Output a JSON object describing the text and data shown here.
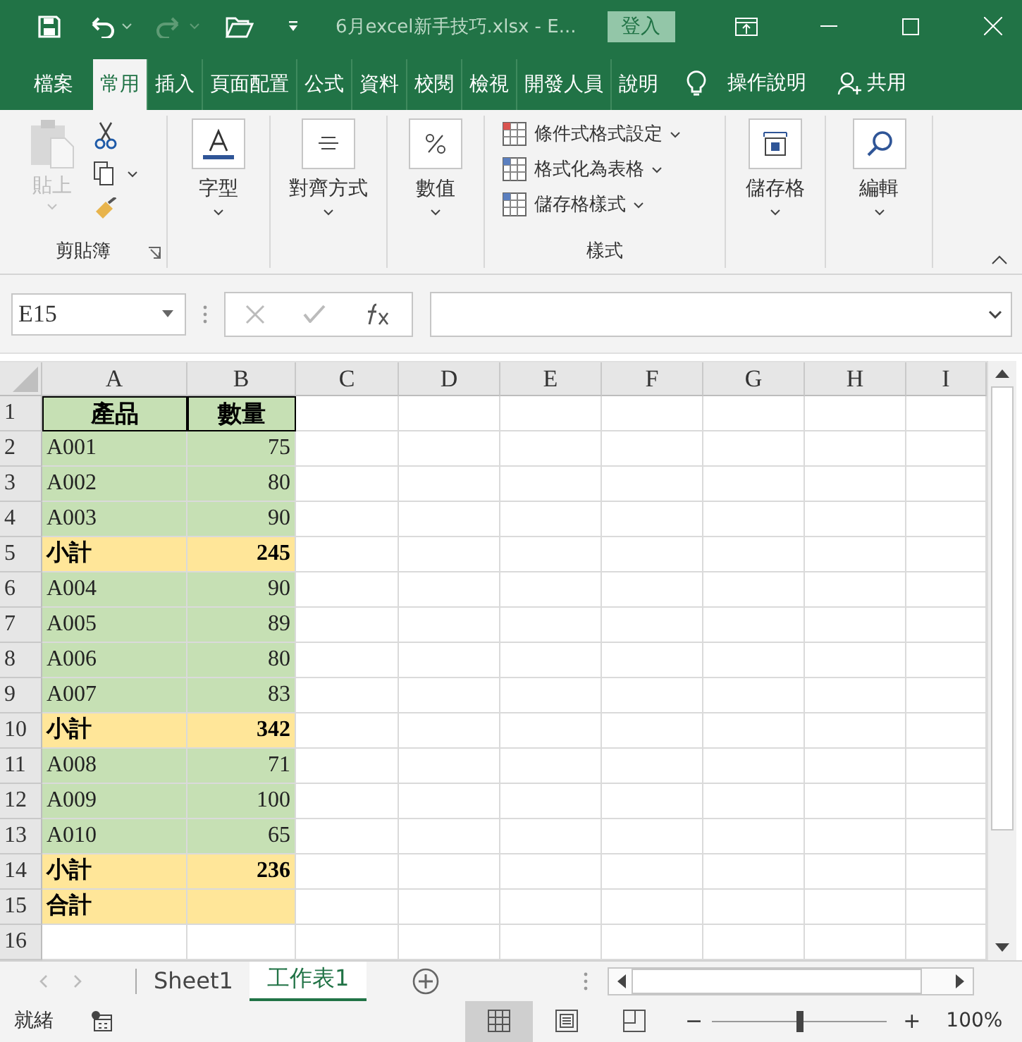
{
  "title_bar": {
    "file_title": "6月excel新手技巧.xlsx  -  E...",
    "sign_in": "登入"
  },
  "ribbon_tabs": [
    {
      "label": "檔案",
      "selected": false
    },
    {
      "label": "常用",
      "selected": true
    },
    {
      "label": "插入",
      "selected": false
    },
    {
      "label": "頁面配置",
      "selected": false
    },
    {
      "label": "公式",
      "selected": false
    },
    {
      "label": "資料",
      "selected": false
    },
    {
      "label": "校閱",
      "selected": false
    },
    {
      "label": "檢視",
      "selected": false
    },
    {
      "label": "開發人員",
      "selected": false
    },
    {
      "label": "說明",
      "selected": false
    }
  ],
  "tell_me": "操作說明",
  "share": "共用",
  "ribbon": {
    "paste": "貼上",
    "clipboard_label": "剪貼簿",
    "font": "字型",
    "alignment": "對齊方式",
    "number": "數值",
    "styles": [
      "條件式格式設定",
      "格式化為表格",
      "儲存格樣式"
    ],
    "styles_label": "樣式",
    "cells": "儲存格",
    "editing": "編輯"
  },
  "name_box": "E15",
  "columns": [
    "A",
    "B",
    "C",
    "D",
    "E",
    "F",
    "G",
    "H",
    "I"
  ],
  "rows": [
    {
      "number": "1",
      "kind": "header",
      "a": "產品",
      "b": "數量"
    },
    {
      "number": "2",
      "kind": "item",
      "a": "A001",
      "b": "75"
    },
    {
      "number": "3",
      "kind": "item",
      "a": "A002",
      "b": "80"
    },
    {
      "number": "4",
      "kind": "item",
      "a": "A003",
      "b": "90"
    },
    {
      "number": "5",
      "kind": "subtotal",
      "a": "小計",
      "b": "245"
    },
    {
      "number": "6",
      "kind": "item",
      "a": "A004",
      "b": "90"
    },
    {
      "number": "7",
      "kind": "item",
      "a": "A005",
      "b": "89"
    },
    {
      "number": "8",
      "kind": "item",
      "a": "A006",
      "b": "80"
    },
    {
      "number": "9",
      "kind": "item",
      "a": "A007",
      "b": "83"
    },
    {
      "number": "10",
      "kind": "subtotal",
      "a": "小計",
      "b": "342"
    },
    {
      "number": "11",
      "kind": "item",
      "a": "A008",
      "b": "71"
    },
    {
      "number": "12",
      "kind": "item",
      "a": "A009",
      "b": "100"
    },
    {
      "number": "13",
      "kind": "item",
      "a": "A010",
      "b": "65"
    },
    {
      "number": "14",
      "kind": "subtotal",
      "a": "小計",
      "b": "236"
    },
    {
      "number": "15",
      "kind": "subtotal",
      "a": "合計"
    },
    {
      "number": "16",
      "kind": "blank"
    }
  ],
  "sheet_tabs": [
    {
      "label": "Sheet1",
      "selected": false
    },
    {
      "label": "工作表1",
      "selected": true
    }
  ],
  "status": "就緒",
  "view_modes": [
    {
      "kind": "normal",
      "selected": true
    },
    {
      "kind": "page_layout",
      "selected": false
    },
    {
      "kind": "page_break",
      "selected": false
    }
  ],
  "zoom": {
    "minus": "−",
    "plus": "+",
    "level": 0.5,
    "reading": "100%"
  }
}
